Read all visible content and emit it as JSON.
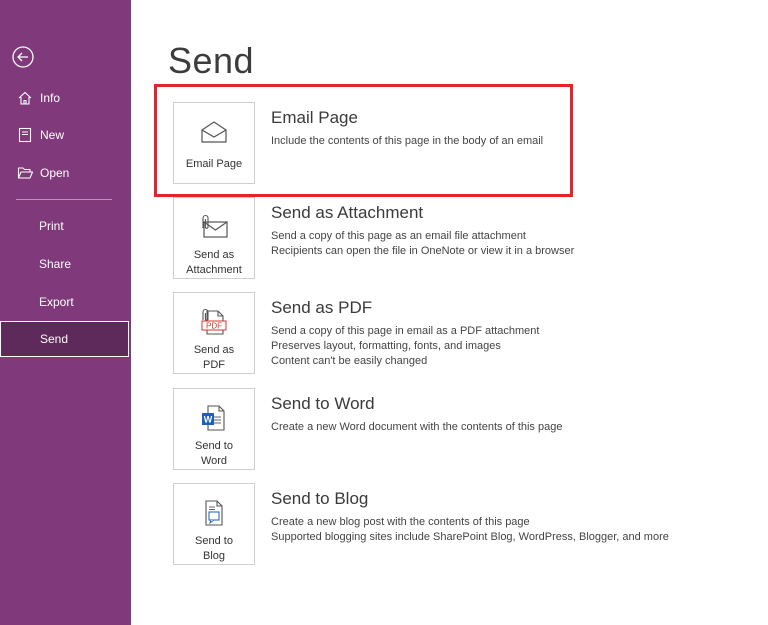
{
  "sidebar": {
    "items": [
      {
        "label": "Info",
        "icon": "home-icon"
      },
      {
        "label": "New",
        "icon": "new-page-icon"
      },
      {
        "label": "Open",
        "icon": "folder-open-icon"
      },
      {
        "label": "Print"
      },
      {
        "label": "Share"
      },
      {
        "label": "Export"
      },
      {
        "label": "Send",
        "selected": true
      }
    ]
  },
  "main": {
    "title": "Send",
    "options": [
      {
        "tile_label": "Email Page",
        "title": "Email Page",
        "desc": [
          "Include the contents of this page in the body of an email"
        ],
        "icon": "envelope-icon",
        "highlighted": true
      },
      {
        "tile_label_lines": [
          "Send as",
          "Attachment"
        ],
        "title": "Send as Attachment",
        "desc": [
          "Send a copy of this page as an email file attachment",
          "Recipients can open the file in OneNote or view it in a browser"
        ],
        "icon": "attachment-envelope-icon"
      },
      {
        "tile_label_lines": [
          "Send as",
          "PDF"
        ],
        "title": "Send as PDF",
        "desc": [
          "Send a copy of this page in email as a PDF attachment",
          "Preserves layout, formatting, fonts, and images",
          "Content can't be easily changed"
        ],
        "icon": "pdf-attachment-icon",
        "pdf_badge": "PDF"
      },
      {
        "tile_label_lines": [
          "Send to",
          "Word"
        ],
        "title": "Send to Word",
        "desc": [
          "Create a new Word document with the contents of this page"
        ],
        "icon": "word-document-icon",
        "word_badge": "W"
      },
      {
        "tile_label_lines": [
          "Send to",
          "Blog"
        ],
        "title": "Send to Blog",
        "desc": [
          "Create a new blog post with the contents of this page",
          "Supported blogging sites include SharePoint Blog, WordPress, Blogger, and more"
        ],
        "icon": "blog-post-icon"
      }
    ]
  },
  "colors": {
    "sidebar": "#80397b",
    "selected": "#5e2a5b",
    "highlight": "#e3242b"
  }
}
